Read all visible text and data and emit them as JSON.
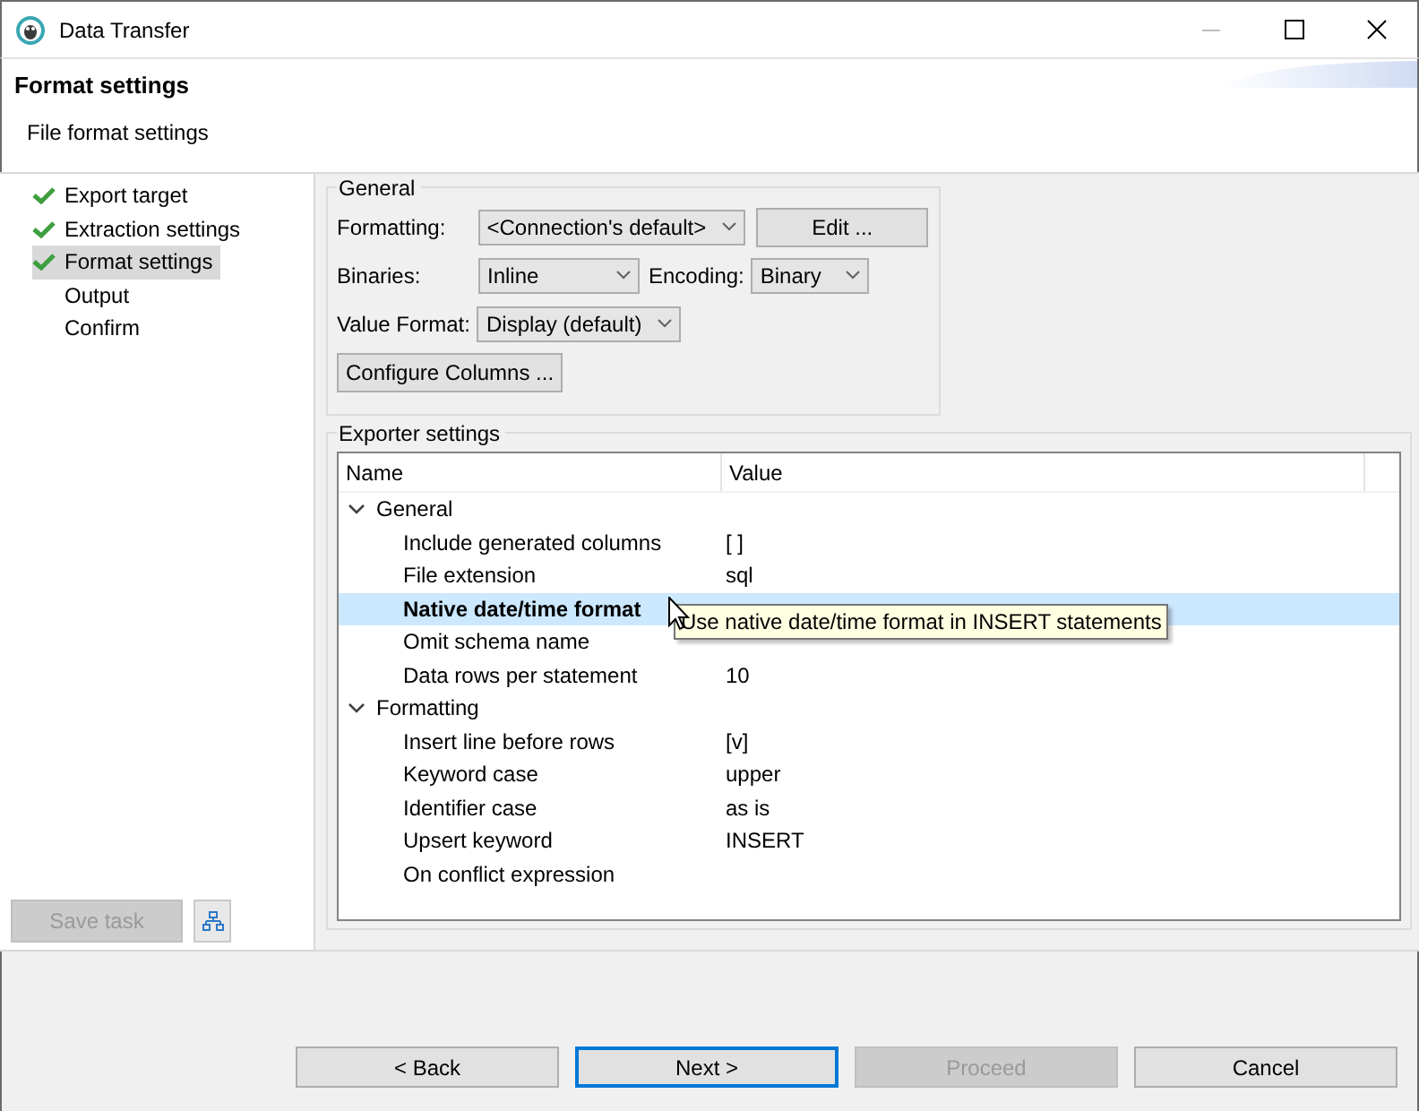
{
  "window": {
    "title": "Data Transfer"
  },
  "header": {
    "title": "Format settings",
    "subtitle": "File format settings"
  },
  "steps": [
    {
      "label": "Export target",
      "completed": true,
      "selected": false
    },
    {
      "label": "Extraction settings",
      "completed": true,
      "selected": false
    },
    {
      "label": "Format settings",
      "completed": true,
      "selected": true
    },
    {
      "label": "Output",
      "completed": false,
      "selected": false
    },
    {
      "label": "Confirm",
      "completed": false,
      "selected": false
    }
  ],
  "save_task": {
    "label": "Save task",
    "disabled": true
  },
  "general": {
    "title": "General",
    "formatting": {
      "label": "Formatting:",
      "value": "<Connection's default>"
    },
    "edit_button": "Edit ...",
    "binaries": {
      "label": "Binaries:",
      "value": "Inline"
    },
    "encoding": {
      "label": "Encoding:",
      "value": "Binary"
    },
    "value_format": {
      "label": "Value Format:",
      "value": "Display (default)"
    },
    "configure_button": "Configure Columns ..."
  },
  "exporter": {
    "title": "Exporter settings",
    "columns": [
      "Name",
      "Value"
    ],
    "groups": [
      {
        "name": "General",
        "expanded": true,
        "children": [
          {
            "name": "Include generated columns",
            "value": "[ ]",
            "selected": false
          },
          {
            "name": "File extension",
            "value": "sql",
            "selected": false
          },
          {
            "name": "Native date/time format",
            "selected": true
          },
          {
            "name": "Omit schema name",
            "selected": false
          },
          {
            "name": "Data rows per statement",
            "value": "10",
            "selected": false
          }
        ]
      },
      {
        "name": "Formatting",
        "expanded": true,
        "children": [
          {
            "name": "Insert line before rows",
            "value": "[v]",
            "selected": false
          },
          {
            "name": "Keyword case",
            "value": "upper",
            "selected": false
          },
          {
            "name": "Identifier case",
            "value": "as is",
            "selected": false
          },
          {
            "name": "Upsert keyword",
            "value": "INSERT",
            "selected": false
          },
          {
            "name": "On conflict expression",
            "selected": false
          }
        ]
      }
    ],
    "tooltip": "Use native date/time format in INSERT statements"
  },
  "buttons": [
    {
      "label": "< Back",
      "disabled": false,
      "default": false
    },
    {
      "label": "Next >",
      "disabled": false,
      "default": true
    },
    {
      "label": "Proceed",
      "disabled": true,
      "default": false
    },
    {
      "label": "Cancel",
      "disabled": false,
      "default": false
    }
  ]
}
